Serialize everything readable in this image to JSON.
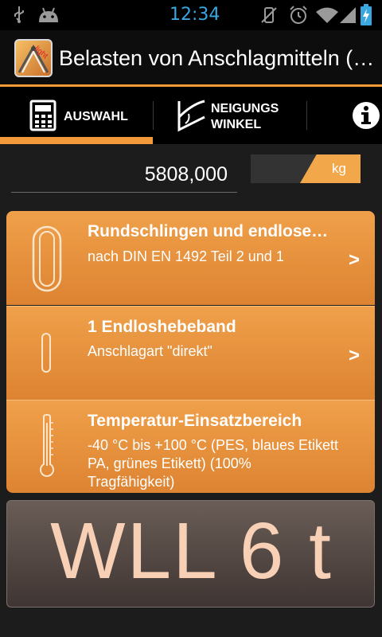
{
  "status_bar": {
    "time": "12:34",
    "icons": [
      "usb-icon",
      "android-icon",
      "vibrate-mute-icon",
      "alarm-icon",
      "wifi-icon",
      "signal-icon",
      "battery-charging-icon"
    ]
  },
  "action_bar": {
    "title": "Belasten von Anschlagmitteln (…",
    "icon": "app-logo",
    "icon_badge": "light"
  },
  "tabs": [
    {
      "label": "AUSWAHL",
      "icon": "calculator-icon",
      "selected": true
    },
    {
      "label_line1": "NEIGUNGS",
      "label_line2": "WINKEL",
      "icon": "angle-icon",
      "selected": false
    },
    {
      "icon": "info-icon"
    }
  ],
  "weight": {
    "value": "5808,000",
    "unit": "kg"
  },
  "selection": [
    {
      "title": "Rundschlingen und endlose…",
      "subtitle": "nach DIN EN 1492 Teil 2 und 1",
      "icon": "round-sling-icon",
      "chevron": ">"
    },
    {
      "title": "1 Endloshebeband",
      "subtitle": "Anschlagart \"direkt\"",
      "icon": "single-sling-icon",
      "chevron": ">"
    },
    {
      "title": "Temperatur-Einsatzbereich",
      "subtitle_lines": [
        "-40 °C bis +100 °C (PES, blaues Etikett",
        "PA, grünes Etikett) (100%",
        "Tragfähigkeit)"
      ],
      "icon": "thermometer-icon"
    }
  ],
  "result": {
    "text": "WLL 6 t"
  },
  "colors": {
    "accent": "#f29a3a",
    "status_time": "#3aa7e0",
    "wll_text": "#f8d0b6"
  }
}
